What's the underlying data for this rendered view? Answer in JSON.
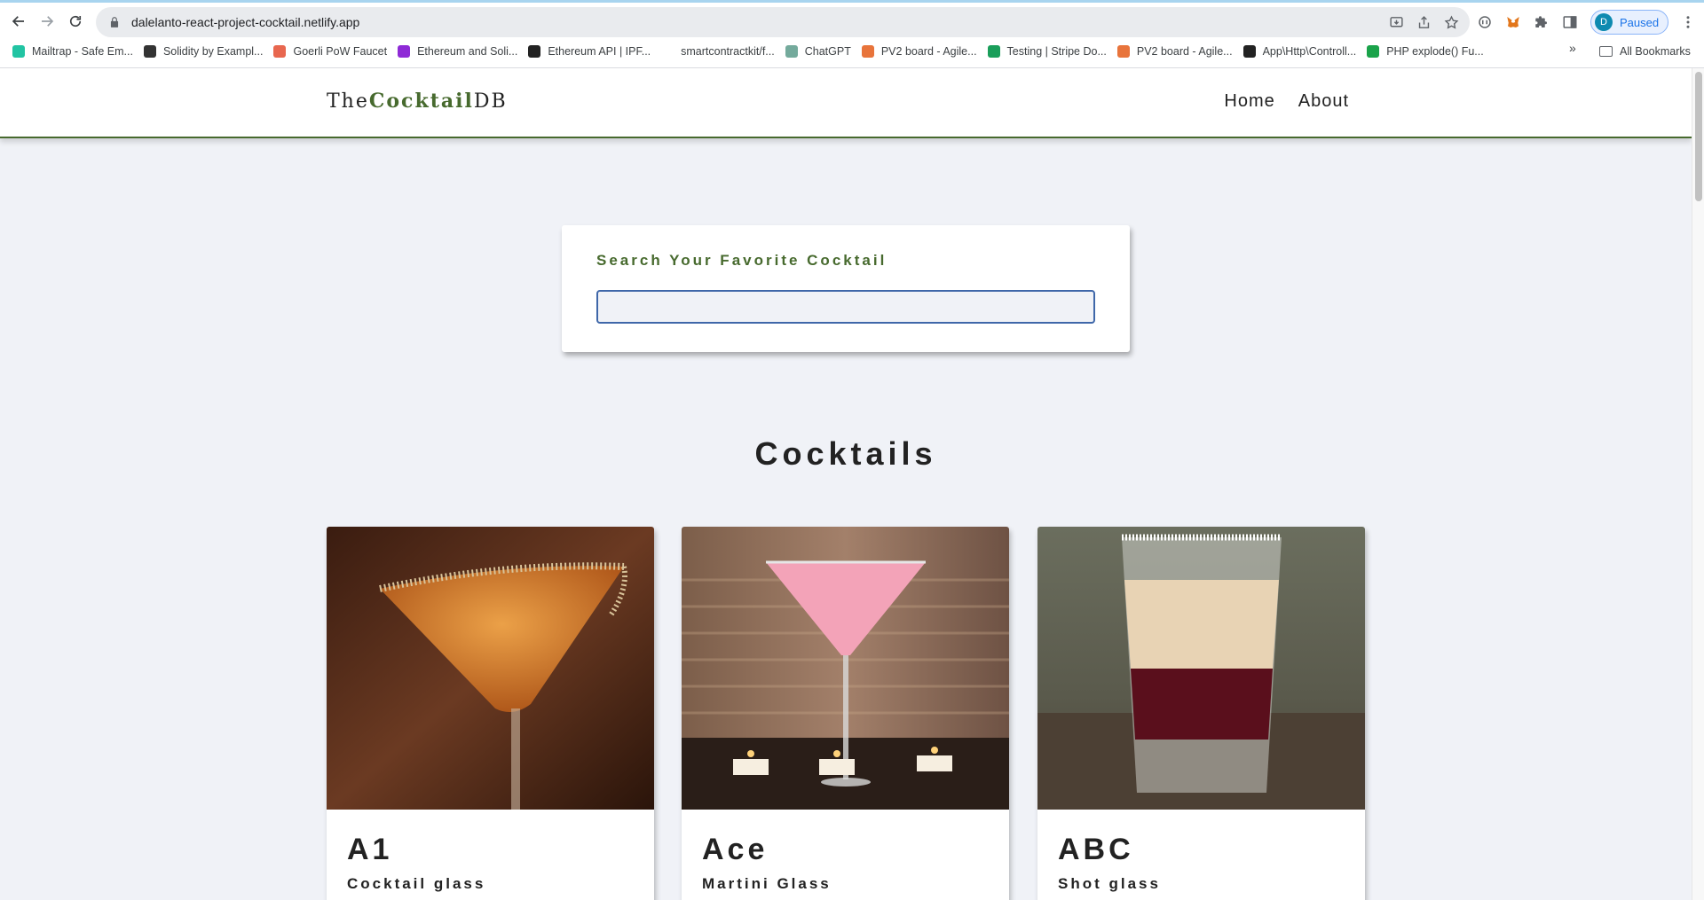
{
  "browser": {
    "url": "dalelanto-react-project-cocktail.netlify.app",
    "profile_initial": "D",
    "profile_status": "Paused",
    "bookmarks": [
      {
        "label": "Mailtrap - Safe Em...",
        "icon_color": "#22c4a3"
      },
      {
        "label": "Solidity by Exampl...",
        "icon_color": "#333333"
      },
      {
        "label": "Goerli PoW Faucet",
        "icon_color": "#e8674f"
      },
      {
        "label": "Ethereum and Soli...",
        "icon_color": "#8e2ad6"
      },
      {
        "label": "Ethereum API | IPF...",
        "icon_color": "#222222"
      },
      {
        "label": "smartcontractkit/f...",
        "icon_color": "#ffffff"
      },
      {
        "label": "ChatGPT",
        "icon_color": "#74aa9c"
      },
      {
        "label": "PV2 board - Agile...",
        "icon_color": "#e8743b"
      },
      {
        "label": "Testing | Stripe Do...",
        "icon_color": "#1a9e5a"
      },
      {
        "label": "PV2 board - Agile...",
        "icon_color": "#e8743b"
      },
      {
        "label": "App\\Http\\Controll...",
        "icon_color": "#222222"
      },
      {
        "label": "PHP explode() Fu...",
        "icon_color": "#1aa34a"
      }
    ],
    "bookmarks_more": "»",
    "all_bookmarks": "All Bookmarks"
  },
  "site": {
    "logo_prefix": "The",
    "logo_bold": "Cocktail",
    "logo_suffix": "DB",
    "nav": {
      "home": "Home",
      "about": "About"
    },
    "accent_color": "#476a2e"
  },
  "search": {
    "label": "Search Your Favorite Cocktail",
    "value": "",
    "placeholder": ""
  },
  "section_title": "Cocktails",
  "cocktails": [
    {
      "name": "A1",
      "glass": "Cocktail glass"
    },
    {
      "name": "Ace",
      "glass": "Martini Glass"
    },
    {
      "name": "ABC",
      "glass": "Shot glass"
    }
  ]
}
